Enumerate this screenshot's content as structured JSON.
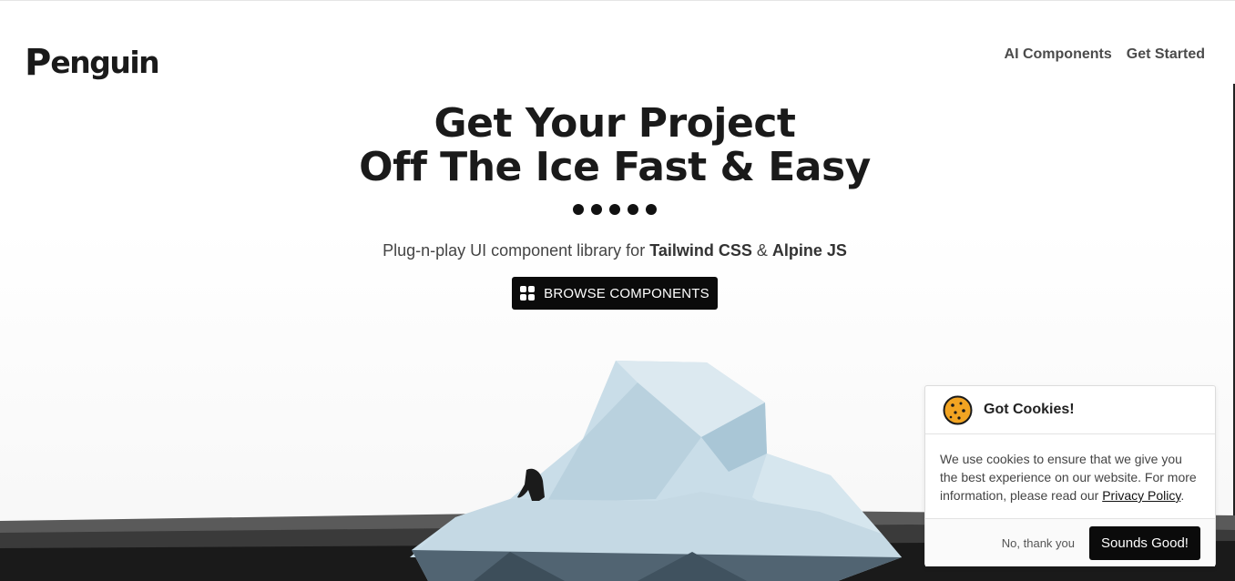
{
  "header": {
    "logo_initial": "P",
    "logo_rest": "enguin",
    "nav": [
      {
        "label": "AI Components"
      },
      {
        "label": "Get Started"
      }
    ]
  },
  "hero": {
    "title_line1": "Get Your Project",
    "title_line2": "Off The Ice Fast & Easy",
    "subtitle_prefix": "Plug-n-play UI component library for ",
    "subtitle_brand1": "Tailwind CSS",
    "subtitle_amp": " & ",
    "subtitle_brand2": "Alpine JS",
    "cta_label": "BROWSE COMPONENTS",
    "cta_icon": "grid-icon"
  },
  "cookie_banner": {
    "icon": "cookie-icon",
    "title": "Got Cookies!",
    "body_text": "We use cookies to ensure that we give you the best experience on our website. For more information, please read our ",
    "link_text": "Privacy Policy",
    "body_suffix": ".",
    "decline_label": "No, thank you",
    "accept_label": "Sounds Good!"
  },
  "colors": {
    "primary": "#0b0b0b",
    "text": "#1a1a1a",
    "ice": "#c9dde8",
    "cookie": "#f2a422"
  }
}
